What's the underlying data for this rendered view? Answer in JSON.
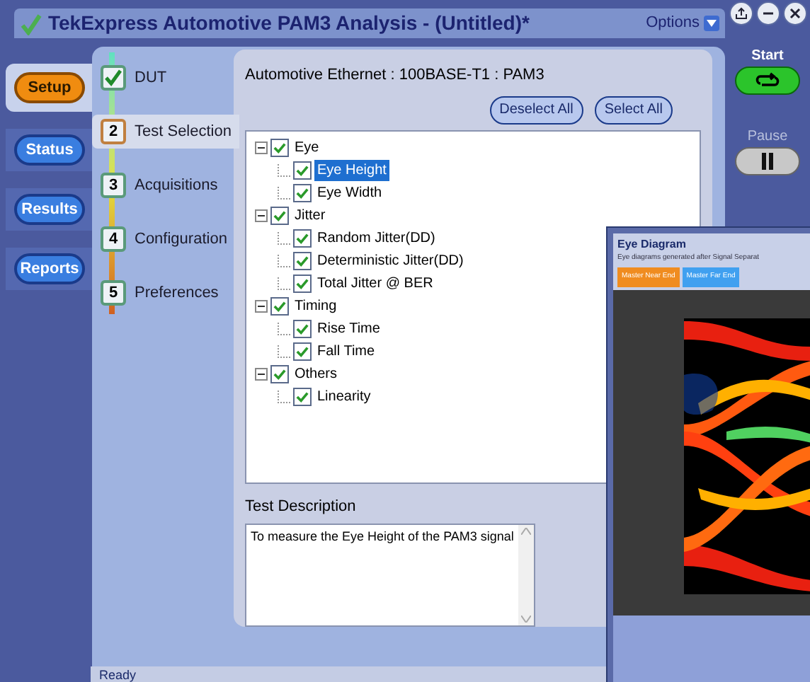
{
  "window": {
    "title": "TekExpress Automotive PAM3 Analysis  -  (Untitled)*",
    "options": "Options"
  },
  "nav": [
    {
      "label": "Setup",
      "selected": true
    },
    {
      "label": "Status",
      "selected": false
    },
    {
      "label": "Results",
      "selected": false
    },
    {
      "label": "Reports",
      "selected": false
    }
  ],
  "steps": [
    {
      "kind": "done",
      "label": "DUT",
      "selected": false
    },
    {
      "kind": "number",
      "number": "2",
      "label": "Test Selection",
      "selected": true
    },
    {
      "kind": "number",
      "number": "3",
      "label": "Acquisitions",
      "selected": false
    },
    {
      "kind": "number",
      "number": "4",
      "label": "Configuration",
      "selected": false
    },
    {
      "kind": "number",
      "number": "5",
      "label": "Preferences",
      "selected": false
    }
  ],
  "panel": {
    "heading": "Automotive Ethernet : 100BASE-T1 : PAM3",
    "buttons": [
      "Deselect All",
      "Select All"
    ]
  },
  "tree": [
    {
      "label": "Eye",
      "checked": true,
      "expanded": true,
      "selected": false,
      "children": [
        {
          "label": "Eye Height",
          "checked": true,
          "selected": true
        },
        {
          "label": "Eye Width",
          "checked": true,
          "selected": false
        }
      ]
    },
    {
      "label": "Jitter",
      "checked": true,
      "expanded": true,
      "selected": false,
      "children": [
        {
          "label": "Random Jitter(DD)",
          "checked": true,
          "selected": false
        },
        {
          "label": "Deterministic Jitter(DD)",
          "checked": true,
          "selected": false
        },
        {
          "label": "Total Jitter @ BER",
          "checked": true,
          "selected": false
        }
      ]
    },
    {
      "label": "Timing",
      "checked": true,
      "expanded": true,
      "selected": false,
      "children": [
        {
          "label": "Rise Time",
          "checked": true,
          "selected": false
        },
        {
          "label": "Fall Time",
          "checked": true,
          "selected": false
        }
      ]
    },
    {
      "label": "Others",
      "checked": true,
      "expanded": true,
      "selected": false,
      "children": [
        {
          "label": "Linearity",
          "checked": true,
          "selected": false
        }
      ]
    }
  ],
  "description": {
    "label": "Test Description",
    "text": "To measure the Eye Height of the PAM3 signal"
  },
  "run": {
    "start": "Start",
    "pause": "Pause",
    "pause_disabled": true
  },
  "status_bar": {
    "text": "Ready"
  },
  "eye_window": {
    "title": "Eye Diagram",
    "subtitle": "Eye diagrams generated after Signal Separat",
    "tabs": [
      {
        "label": "Master Near End",
        "selected": true
      },
      {
        "label": "Master Far End",
        "selected": false
      }
    ]
  }
}
